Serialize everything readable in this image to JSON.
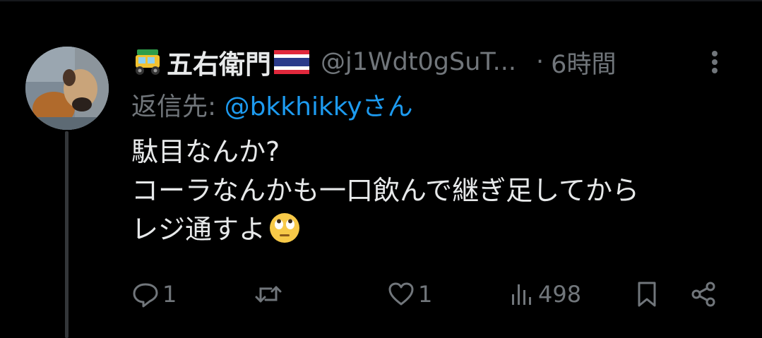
{
  "post": {
    "author": {
      "display_name": "五右衛門",
      "handle": "@j1Wdt0gSuT...",
      "leading_emoji": "auto-rickshaw",
      "trailing_emoji": "flag-thailand"
    },
    "separator": "·",
    "time": "6時間",
    "reply_to": {
      "prefix": "返信先: ",
      "mention": "@bkkhikky",
      "suffix": "さん"
    },
    "body": {
      "line1": "駄目なんか?",
      "line2": "コーラなんかも一口飲んで継ぎ足してから",
      "line3": "レジ通すよ",
      "trailing_emoji": "face-with-rolling-eyes"
    },
    "actions": {
      "reply_count": "1",
      "repost_count": "",
      "like_count": "1",
      "views_count": "498"
    }
  },
  "colors": {
    "background": "#000000",
    "primary_text": "#e7e9ea",
    "secondary_text": "#71767b",
    "link": "#1d9bf0",
    "thread_line": "#333639"
  }
}
